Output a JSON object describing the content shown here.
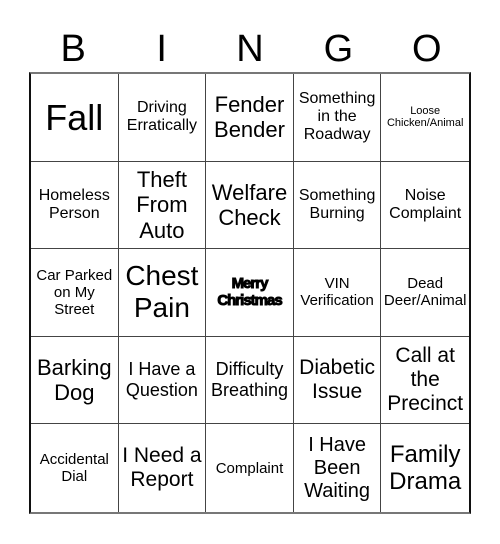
{
  "header": [
    "B",
    "I",
    "N",
    "G",
    "O"
  ],
  "cells": [
    "Fall",
    "Driving Erratically",
    "Fender Bender",
    "Something in the Roadway",
    "Loose Chicken/Animal",
    "Homeless Person",
    "Theft From Auto",
    "Welfare Check",
    "Something Burning",
    "Noise Complaint",
    "Car Parked on My Street",
    "Chest Pain",
    "Merry Christmas",
    "VIN Verification",
    "Dead Deer/Animal",
    "Barking Dog",
    "I Have a Question",
    "Difficulty Breathing",
    "Diabetic Issue",
    "Call at the Precinct",
    "Accidental Dial",
    "I Need a Report",
    "Complaint",
    "I Have Been Waiting",
    "Family Drama"
  ],
  "free_space_index": 12
}
